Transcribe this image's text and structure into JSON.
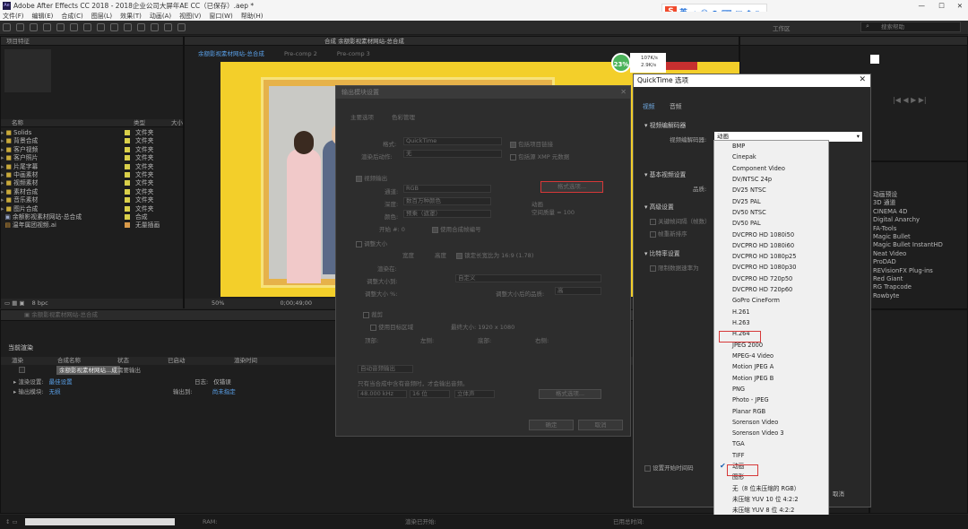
{
  "window": {
    "title": "Adobe After Effects CC 2018 - 2018企业公司大屏年AE CC（已保存）.aep *"
  },
  "menu": [
    "文件(F)",
    "编辑(E)",
    "合成(C)",
    "图层(L)",
    "效果(T)",
    "动画(A)",
    "视图(V)",
    "窗口(W)",
    "帮助(H)"
  ],
  "project": {
    "header": "项目特征",
    "columns": {
      "name": "名称",
      "type": "类型",
      "size": "大小"
    },
    "items": [
      {
        "name": "Solids",
        "type": "文件夹"
      },
      {
        "name": "背景合成",
        "type": "文件夹"
      },
      {
        "name": "客户视频",
        "type": "文件夹"
      },
      {
        "name": "客户照片",
        "type": "文件夹"
      },
      {
        "name": "片尾字幕",
        "type": "文件夹"
      },
      {
        "name": "中画素材",
        "type": "文件夹"
      },
      {
        "name": "视频素材",
        "type": "文件夹"
      },
      {
        "name": "素材合成",
        "type": "文件夹"
      },
      {
        "name": "音乐素材",
        "type": "文件夹"
      },
      {
        "name": "图片合成",
        "type": "文件夹"
      },
      {
        "name": "余额影视素材网站-总合成",
        "type": "合成"
      },
      {
        "name": "温年属团视频.ai",
        "type": "无量插画"
      }
    ],
    "bpc": "8 bpc"
  },
  "viewer": {
    "tabs": [
      "合成 余额影视素材网站-总合成"
    ],
    "flow": [
      "余额影视素材网站-总合成",
      "Pre-comp 2",
      "Pre-comp 3"
    ],
    "zoom": "50%",
    "timecode": "0;00;49;00",
    "percent": "23%",
    "net_up": "107K/s",
    "net_down": "2.9K/s"
  },
  "render": {
    "panel_title": "当前渲染",
    "columns": [
      "渲染",
      "合成名称",
      "状态",
      "已启动",
      "渲染时间"
    ],
    "item_name": "余额影视素材网站...成",
    "item_status": "需要输出",
    "settings_label": "渲染设置:",
    "settings_value": "最佳设置",
    "output_label": "输出模块:",
    "output_value": "无损",
    "log_label": "日志:",
    "log_value": "仅错误",
    "output_to_label": "输出到:",
    "output_to_value": "尚未指定"
  },
  "output_dialog": {
    "title": "输出模块设置",
    "tabs": [
      "主要选项",
      "色彩管理"
    ],
    "format_label": "格式:",
    "format_value": "QuickTime",
    "include_project": "包括项目链接",
    "post_render_label": "渲染后动作:",
    "post_render_value": "无",
    "include_xmp": "包括源 XMP 元数据",
    "video_output": "视频输出",
    "channels_label": "通道:",
    "channels_value": "RGB",
    "depth_label": "深度:",
    "depth_value": "数百万种颜色",
    "color_label": "颜色:",
    "color_value": "预乘（遮罩）",
    "start_label": "开始 #:",
    "start_value": "0",
    "use_comp_frame": "使用合成帧编号",
    "format_options": "格式选项...",
    "codec_info": "动画",
    "spatial": "空间质量 = 100",
    "resize": "调整大小",
    "width": "宽度",
    "height": "高度",
    "lock_ratio": "锁定长宽比为 16:9 (1.78)",
    "render_at": "渲染在:",
    "resize_to": "调整大小到:",
    "custom": "自定义",
    "resize_pct": "调整大小 %:",
    "resize_quality": "调整大小后的品质:",
    "quality_value": "高",
    "crop": "裁剪",
    "use_roi": "使用目标区域",
    "final_size": "最终大小: 1920 x 1080",
    "top": "顶部:",
    "left": "左侧:",
    "bottom": "底部:",
    "right": "右侧:",
    "audio_label": "自动音频输出",
    "audio_note": "只有当合成中含有音频时，才会输出音频。",
    "khz": "48.000 kHz",
    "bit": "16 位",
    "stereo": "立体声",
    "ok": "确定",
    "cancel": "取消"
  },
  "qt_dialog": {
    "title": "QuickTime 选项",
    "tabs": [
      "视频",
      "音频"
    ],
    "video_codec_section": "视频编解码器",
    "codec_label": "视频编解码器:",
    "codec_value": "动画",
    "basic_section": "基本视频设置",
    "quality_label": "品质:",
    "advanced_section": "高级设置",
    "keyframe": "关键帧间隔（帧数）",
    "frame_reorder": "帧重新排序",
    "bitrate_section": "比特率设置",
    "limit_bitrate": "限制数据速率为",
    "set_start_timecode": "设置开始时间码",
    "cancel": "取消"
  },
  "codec_options": [
    "BMP",
    "Cinepak",
    "Component Video",
    "DV/NTSC 24p",
    "DV25 NTSC",
    "DV25 PAL",
    "DV50 NTSC",
    "DV50 PAL",
    "DVCPRO HD 1080i50",
    "DVCPRO HD 1080i60",
    "DVCPRO HD 1080p25",
    "DVCPRO HD 1080p30",
    "DVCPRO HD 720p50",
    "DVCPRO HD 720p60",
    "GoPro CineForm",
    "H.261",
    "H.263",
    "H.264",
    "JPEG 2000",
    "MPEG-4 Video",
    "Motion JPEG A",
    "Motion JPEG B",
    "PNG",
    "Photo - JPEG",
    "Planar RGB",
    "Sorenson Video",
    "Sorenson Video 3",
    "TGA",
    "TIFF",
    "动画",
    "图形",
    "无（8 位未压缩的 RGB）",
    "未压缩 YUV 10 位 4:2:2",
    "未压缩 YUV 8 位 4:2:2"
  ],
  "effects_list": [
    "动画预设",
    "3D 通道",
    "CINEMA 4D",
    "Digital Anarchy",
    "FA-Tools",
    "Magic Bullet",
    "Magic Bullet InstantHD",
    "Neat Video",
    "ProDAD",
    "REVisionFX Plug-ins",
    "Red Giant",
    "RG Trapcode",
    "Rowbyte"
  ],
  "right_top": {
    "workspace": "工作区",
    "search": "搜索帮助"
  },
  "status": {
    "ram": "RAM:",
    "render_start": "渲染已开始:",
    "elapsed": "已用总时间:"
  },
  "ime": {
    "logo": "S",
    "label": "英"
  },
  "colors": {
    "accent_blue": "#2d8ceb",
    "highlight_red": "#d63838",
    "label_yellow": "#d9cf4a",
    "comp_gold": "#f0c419"
  },
  "icons": [
    "close-icon",
    "minimize-icon",
    "maximize-icon",
    "folder-icon",
    "composition-icon",
    "checkmark-icon",
    "dropdown-arrow-icon"
  ]
}
